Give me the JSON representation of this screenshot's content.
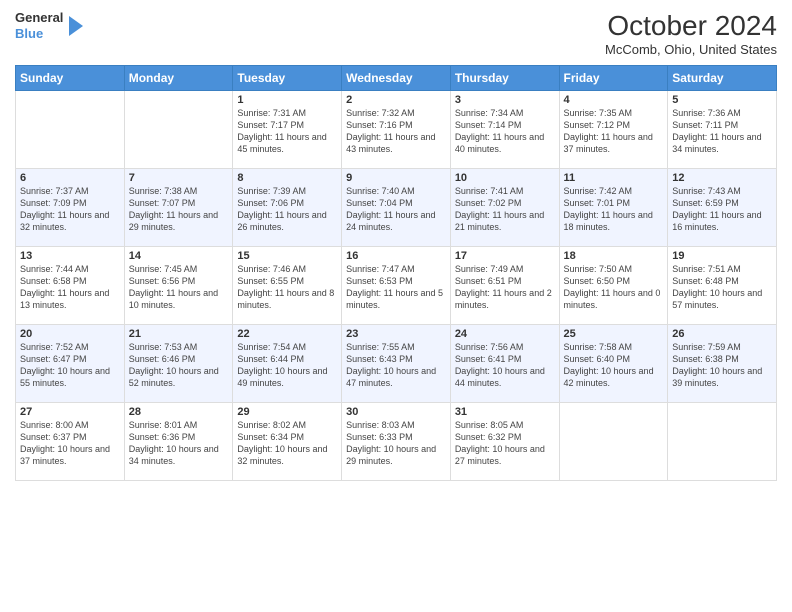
{
  "logo": {
    "line1": "General",
    "line2": "Blue"
  },
  "title": "October 2024",
  "subtitle": "McComb, Ohio, United States",
  "days_of_week": [
    "Sunday",
    "Monday",
    "Tuesday",
    "Wednesday",
    "Thursday",
    "Friday",
    "Saturday"
  ],
  "weeks": [
    [
      null,
      null,
      {
        "day": "1",
        "sunrise": "7:31 AM",
        "sunset": "7:17 PM",
        "daylight": "11 hours and 45 minutes."
      },
      {
        "day": "2",
        "sunrise": "7:32 AM",
        "sunset": "7:16 PM",
        "daylight": "11 hours and 43 minutes."
      },
      {
        "day": "3",
        "sunrise": "7:34 AM",
        "sunset": "7:14 PM",
        "daylight": "11 hours and 40 minutes."
      },
      {
        "day": "4",
        "sunrise": "7:35 AM",
        "sunset": "7:12 PM",
        "daylight": "11 hours and 37 minutes."
      },
      {
        "day": "5",
        "sunrise": "7:36 AM",
        "sunset": "7:11 PM",
        "daylight": "11 hours and 34 minutes."
      }
    ],
    [
      {
        "day": "6",
        "sunrise": "7:37 AM",
        "sunset": "7:09 PM",
        "daylight": "11 hours and 32 minutes."
      },
      {
        "day": "7",
        "sunrise": "7:38 AM",
        "sunset": "7:07 PM",
        "daylight": "11 hours and 29 minutes."
      },
      {
        "day": "8",
        "sunrise": "7:39 AM",
        "sunset": "7:06 PM",
        "daylight": "11 hours and 26 minutes."
      },
      {
        "day": "9",
        "sunrise": "7:40 AM",
        "sunset": "7:04 PM",
        "daylight": "11 hours and 24 minutes."
      },
      {
        "day": "10",
        "sunrise": "7:41 AM",
        "sunset": "7:02 PM",
        "daylight": "11 hours and 21 minutes."
      },
      {
        "day": "11",
        "sunrise": "7:42 AM",
        "sunset": "7:01 PM",
        "daylight": "11 hours and 18 minutes."
      },
      {
        "day": "12",
        "sunrise": "7:43 AM",
        "sunset": "6:59 PM",
        "daylight": "11 hours and 16 minutes."
      }
    ],
    [
      {
        "day": "13",
        "sunrise": "7:44 AM",
        "sunset": "6:58 PM",
        "daylight": "11 hours and 13 minutes."
      },
      {
        "day": "14",
        "sunrise": "7:45 AM",
        "sunset": "6:56 PM",
        "daylight": "11 hours and 10 minutes."
      },
      {
        "day": "15",
        "sunrise": "7:46 AM",
        "sunset": "6:55 PM",
        "daylight": "11 hours and 8 minutes."
      },
      {
        "day": "16",
        "sunrise": "7:47 AM",
        "sunset": "6:53 PM",
        "daylight": "11 hours and 5 minutes."
      },
      {
        "day": "17",
        "sunrise": "7:49 AM",
        "sunset": "6:51 PM",
        "daylight": "11 hours and 2 minutes."
      },
      {
        "day": "18",
        "sunrise": "7:50 AM",
        "sunset": "6:50 PM",
        "daylight": "11 hours and 0 minutes."
      },
      {
        "day": "19",
        "sunrise": "7:51 AM",
        "sunset": "6:48 PM",
        "daylight": "10 hours and 57 minutes."
      }
    ],
    [
      {
        "day": "20",
        "sunrise": "7:52 AM",
        "sunset": "6:47 PM",
        "daylight": "10 hours and 55 minutes."
      },
      {
        "day": "21",
        "sunrise": "7:53 AM",
        "sunset": "6:46 PM",
        "daylight": "10 hours and 52 minutes."
      },
      {
        "day": "22",
        "sunrise": "7:54 AM",
        "sunset": "6:44 PM",
        "daylight": "10 hours and 49 minutes."
      },
      {
        "day": "23",
        "sunrise": "7:55 AM",
        "sunset": "6:43 PM",
        "daylight": "10 hours and 47 minutes."
      },
      {
        "day": "24",
        "sunrise": "7:56 AM",
        "sunset": "6:41 PM",
        "daylight": "10 hours and 44 minutes."
      },
      {
        "day": "25",
        "sunrise": "7:58 AM",
        "sunset": "6:40 PM",
        "daylight": "10 hours and 42 minutes."
      },
      {
        "day": "26",
        "sunrise": "7:59 AM",
        "sunset": "6:38 PM",
        "daylight": "10 hours and 39 minutes."
      }
    ],
    [
      {
        "day": "27",
        "sunrise": "8:00 AM",
        "sunset": "6:37 PM",
        "daylight": "10 hours and 37 minutes."
      },
      {
        "day": "28",
        "sunrise": "8:01 AM",
        "sunset": "6:36 PM",
        "daylight": "10 hours and 34 minutes."
      },
      {
        "day": "29",
        "sunrise": "8:02 AM",
        "sunset": "6:34 PM",
        "daylight": "10 hours and 32 minutes."
      },
      {
        "day": "30",
        "sunrise": "8:03 AM",
        "sunset": "6:33 PM",
        "daylight": "10 hours and 29 minutes."
      },
      {
        "day": "31",
        "sunrise": "8:05 AM",
        "sunset": "6:32 PM",
        "daylight": "10 hours and 27 minutes."
      },
      null,
      null
    ]
  ],
  "labels": {
    "sunrise": "Sunrise:",
    "sunset": "Sunset:",
    "daylight": "Daylight:"
  }
}
